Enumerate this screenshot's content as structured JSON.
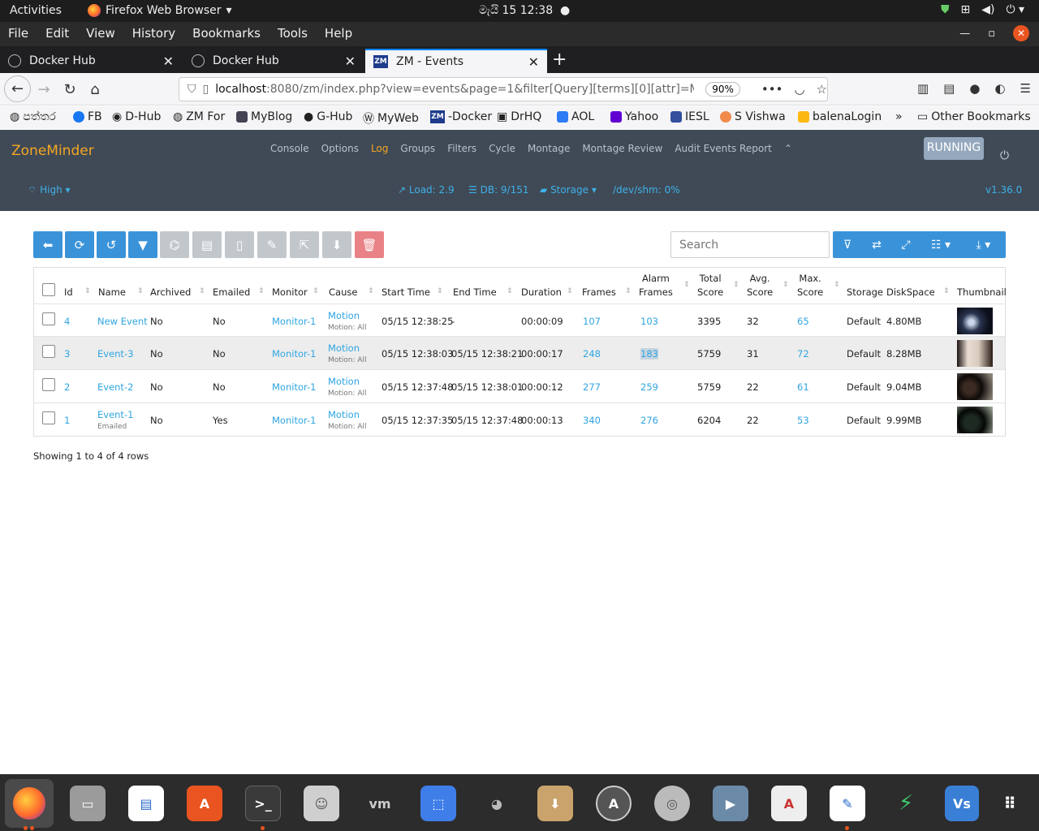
{
  "topbar": {
    "activities": "Activities",
    "app": "Firefox Web Browser",
    "clock": "මැයි 15  12:38"
  },
  "menu": [
    "File",
    "Edit",
    "View",
    "History",
    "Bookmarks",
    "Tools",
    "Help"
  ],
  "tabs": [
    {
      "title": "Docker Hub"
    },
    {
      "title": "Docker Hub"
    },
    {
      "title": "ZM - Events"
    }
  ],
  "url": {
    "host": "localhost",
    "path": ":8080/zm/index.php?view=events&page=1&filter[Query][terms][0][attr]=M",
    "zoom": "90%"
  },
  "bookmarks": [
    "පත්තර",
    "FB",
    "D-Hub",
    "ZM For",
    "MyBlog",
    "G-Hub",
    "MyWeb",
    "-Docker",
    "DrHQ",
    "AOL",
    "Yahoo",
    "IESL",
    "S Vishwa",
    "balenaLogin",
    "Other Bookmarks"
  ],
  "zm": {
    "brand": "ZoneMinder",
    "nav": [
      "Console",
      "Options",
      "Log",
      "Groups",
      "Filters",
      "Cycle",
      "Montage",
      "Montage Review",
      "Audit Events Report"
    ],
    "running": "RUNNING",
    "bandwidth": "High",
    "load": "Load: 2.9",
    "db": "DB: 9/151",
    "storage": "Storage",
    "shm": "/dev/shm: 0%",
    "version": "v1.36.0"
  },
  "search_placeholder": "Search",
  "columns": {
    "id": "Id",
    "name": "Name",
    "archived": "Archived",
    "emailed": "Emailed",
    "monitor": "Monitor",
    "cause": "Cause",
    "start": "Start Time",
    "end": "End Time",
    "duration": "Duration",
    "frames": "Frames",
    "alarm1": "Alarm",
    "alarm2": "Frames",
    "total1": "Total",
    "total2": "Score",
    "avg1": "Avg.",
    "avg2": "Score",
    "max1": "Max.",
    "max2": "Score",
    "storage": "Storage",
    "disk": "DiskSpace",
    "thumb": "Thumbnail"
  },
  "rows": [
    {
      "id": "4",
      "name": "New Event",
      "note": "",
      "archived": "No",
      "emailed": "No",
      "monitor": "Monitor-1",
      "cause": "Motion",
      "cause_sub": "Motion: All",
      "start": "05/15 12:38:25",
      "end": "-",
      "duration": "00:00:09",
      "frames": "107",
      "alarm": "103",
      "total": "3395",
      "avg": "32",
      "max": "65",
      "storage": "Default",
      "disk": "4.80MB"
    },
    {
      "id": "3",
      "name": "Event-3",
      "note": "",
      "archived": "No",
      "emailed": "No",
      "monitor": "Monitor-1",
      "cause": "Motion",
      "cause_sub": "Motion: All",
      "start": "05/15 12:38:03",
      "end": "05/15 12:38:21",
      "duration": "00:00:17",
      "frames": "248",
      "alarm": "183",
      "total": "5759",
      "avg": "31",
      "max": "72",
      "storage": "Default",
      "disk": "8.28MB"
    },
    {
      "id": "2",
      "name": "Event-2",
      "note": "",
      "archived": "No",
      "emailed": "No",
      "monitor": "Monitor-1",
      "cause": "Motion",
      "cause_sub": "Motion: All",
      "start": "05/15 12:37:48",
      "end": "05/15 12:38:01",
      "duration": "00:00:12",
      "frames": "277",
      "alarm": "259",
      "total": "5759",
      "avg": "22",
      "max": "61",
      "storage": "Default",
      "disk": "9.04MB"
    },
    {
      "id": "1",
      "name": "Event-1",
      "note": "Emailed",
      "archived": "No",
      "emailed": "Yes",
      "monitor": "Monitor-1",
      "cause": "Motion",
      "cause_sub": "Motion: All",
      "start": "05/15 12:37:35",
      "end": "05/15 12:37:48",
      "duration": "00:00:13",
      "frames": "340",
      "alarm": "276",
      "total": "6204",
      "avg": "22",
      "max": "53",
      "storage": "Default",
      "disk": "9.99MB"
    }
  ],
  "showing": "Showing 1 to 4 of 4 rows",
  "colors": {
    "accent": "#3a93d9",
    "brand": "#f5a623",
    "header": "#3f4a56",
    "link": "#2fa5e0"
  }
}
